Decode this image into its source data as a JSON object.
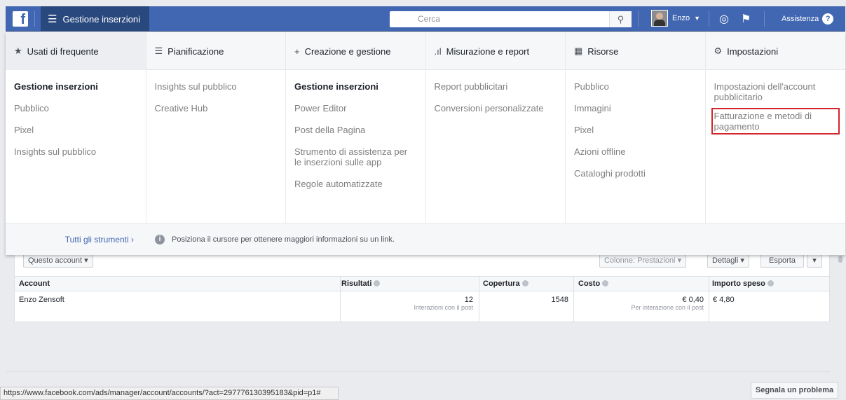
{
  "topbar": {
    "logo": "f",
    "menu_label": "Gestione inserzioni",
    "search_placeholder": "Cerca",
    "user_name": "Enzo",
    "help_label": "Assistenza",
    "help_glyph": "?",
    "bar_color": "#4267b2"
  },
  "mega_menu": {
    "headers": [
      {
        "icon": "★",
        "label": "Usati di frequente"
      },
      {
        "icon": "☰",
        "label": "Pianificazione"
      },
      {
        "icon": "+",
        "label": "Creazione e gestione"
      },
      {
        "icon": ".ıl",
        "label": "Misurazione e report"
      },
      {
        "icon": "▦",
        "label": "Risorse"
      },
      {
        "icon": "⚙",
        "label": "Impostazioni"
      }
    ],
    "columns": [
      {
        "items": [
          "Gestione inserzioni",
          "Pubblico",
          "Pixel",
          "Insights sul pubblico"
        ]
      },
      {
        "items": [
          "Insights sul pubblico",
          "Creative Hub"
        ]
      },
      {
        "items": [
          "Gestione inserzioni",
          "Power Editor",
          "Post della Pagina",
          "Strumento di assistenza per le inserzioni sulle app",
          "Regole automatizzate"
        ]
      },
      {
        "items": [
          "Report pubblicitari",
          "Conversioni personalizzate"
        ]
      },
      {
        "items": [
          "Pubblico",
          "Immagini",
          "Pixel",
          "Azioni offline",
          "Cataloghi prodotti"
        ]
      },
      {
        "items": [
          "Impostazioni dell'account pubblicitario",
          "Fatturazione e metodi di pagamento"
        ]
      }
    ],
    "footer": {
      "all_tools": "Tutti gli strumenti",
      "all_tools_arrow": "›",
      "info_glyph": "i",
      "hint": "Posiziona il cursore per ottenere maggiori informazioni su un link."
    },
    "highlight_color": "#d4252c"
  },
  "toolbar": {
    "account_filter": "Questo account",
    "columns_label": "Colonne: Prestazioni",
    "details_label": "Dettagli",
    "export_label": "Esporta",
    "caret": "▾"
  },
  "table": {
    "headers": [
      "Account",
      "Risultati",
      "Copertura",
      "Costo",
      "Importo speso"
    ],
    "row": {
      "account": "Enzo Zensoft",
      "results": "12",
      "results_sub": "Interazioni con il post",
      "reach": "1548",
      "cost": "€ 0,40",
      "cost_sub": "Per interazione con il post",
      "spent": "€ 4,80"
    }
  },
  "status_bar": {
    "url": "https://www.facebook.com/ads/manager/account/accounts/?act=297776130395183&pid=p1#"
  },
  "report_problem": "Segnala un problema"
}
